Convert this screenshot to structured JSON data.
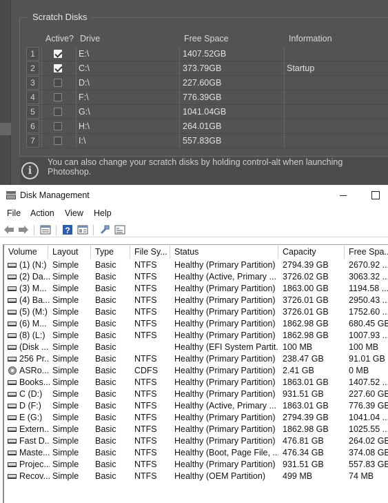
{
  "scratch": {
    "legend": "Scratch Disks",
    "headers": {
      "active": "Active?",
      "drive": "Drive",
      "free_space": "Free Space",
      "information": "Information"
    },
    "rows": [
      {
        "num": "1",
        "active": true,
        "drive": "E:\\",
        "free": "1407.52GB",
        "info": ""
      },
      {
        "num": "2",
        "active": true,
        "drive": "C:\\",
        "free": "373.79GB",
        "info": "Startup"
      },
      {
        "num": "3",
        "active": false,
        "drive": "D:\\",
        "free": "227.60GB",
        "info": ""
      },
      {
        "num": "4",
        "active": false,
        "drive": "F:\\",
        "free": "776.39GB",
        "info": ""
      },
      {
        "num": "5",
        "active": false,
        "drive": "G:\\",
        "free": "1041.04GB",
        "info": ""
      },
      {
        "num": "6",
        "active": false,
        "drive": "H:\\",
        "free": "264.01GB",
        "info": ""
      },
      {
        "num": "7",
        "active": false,
        "drive": "I:\\",
        "free": "557.83GB",
        "info": ""
      }
    ],
    "info_icon": "info-icon",
    "info_text": "You can also change your scratch disks by holding control-alt when launching Photoshop."
  },
  "diskmgmt": {
    "title": "Disk Management",
    "menu": [
      "File",
      "Action",
      "View",
      "Help"
    ],
    "toolbar_icons": [
      "back-arrow-icon",
      "forward-arrow-icon",
      "list-view-icon",
      "help-icon",
      "properties-icon",
      "connect-icon",
      "console-icon"
    ],
    "columns": [
      "Volume",
      "Layout",
      "Type",
      "File Sy...",
      "Status",
      "Capacity",
      "Free Spa..."
    ],
    "rows": [
      {
        "icon": "hdd",
        "volume": "(1) (N:)",
        "layout": "Simple",
        "type": "Basic",
        "fs": "NTFS",
        "status": "Healthy (Primary Partition)",
        "capacity": "2794.39 GB",
        "free": "2670.92 ..."
      },
      {
        "icon": "hdd",
        "volume": "(2) Da...",
        "layout": "Simple",
        "type": "Basic",
        "fs": "NTFS",
        "status": "Healthy (Active, Primary ...",
        "capacity": "3726.02 GB",
        "free": "3063.32 ..."
      },
      {
        "icon": "hdd",
        "volume": "(3) M...",
        "layout": "Simple",
        "type": "Basic",
        "fs": "NTFS",
        "status": "Healthy (Primary Partition)",
        "capacity": "1863.00 GB",
        "free": "1194.58 ..."
      },
      {
        "icon": "hdd",
        "volume": "(4) Ba...",
        "layout": "Simple",
        "type": "Basic",
        "fs": "NTFS",
        "status": "Healthy (Primary Partition)",
        "capacity": "3726.01 GB",
        "free": "2950.43 ..."
      },
      {
        "icon": "hdd",
        "volume": "(5) (M:)",
        "layout": "Simple",
        "type": "Basic",
        "fs": "NTFS",
        "status": "Healthy (Primary Partition)",
        "capacity": "3726.01 GB",
        "free": "1752.60 ..."
      },
      {
        "icon": "hdd",
        "volume": "(6) M...",
        "layout": "Simple",
        "type": "Basic",
        "fs": "NTFS",
        "status": "Healthy (Primary Partition)",
        "capacity": "1862.98 GB",
        "free": "680.45 GB"
      },
      {
        "icon": "hdd",
        "volume": "(8) (L:)",
        "layout": "Simple",
        "type": "Basic",
        "fs": "NTFS",
        "status": "Healthy (Primary Partition)",
        "capacity": "1862.98 GB",
        "free": "1007.93 ..."
      },
      {
        "icon": "hdd",
        "volume": "(Disk ...",
        "layout": "Simple",
        "type": "Basic",
        "fs": "",
        "status": "Healthy (EFI System Partit...",
        "capacity": "100 MB",
        "free": "100 MB"
      },
      {
        "icon": "hdd",
        "volume": "256 Pr...",
        "layout": "Simple",
        "type": "Basic",
        "fs": "NTFS",
        "status": "Healthy (Primary Partition)",
        "capacity": "238.47 GB",
        "free": "91.01 GB"
      },
      {
        "icon": "cd",
        "volume": "ASRo...",
        "layout": "Simple",
        "type": "Basic",
        "fs": "CDFS",
        "status": "Healthy (Primary Partition)",
        "capacity": "2.41 GB",
        "free": "0 MB"
      },
      {
        "icon": "hdd",
        "volume": "Books...",
        "layout": "Simple",
        "type": "Basic",
        "fs": "NTFS",
        "status": "Healthy (Primary Partition)",
        "capacity": "1863.01 GB",
        "free": "1407.52 ..."
      },
      {
        "icon": "hdd",
        "volume": "C (D:)",
        "layout": "Simple",
        "type": "Basic",
        "fs": "NTFS",
        "status": "Healthy (Primary Partition)",
        "capacity": "931.51 GB",
        "free": "227.60 GB"
      },
      {
        "icon": "hdd",
        "volume": "D (F:)",
        "layout": "Simple",
        "type": "Basic",
        "fs": "NTFS",
        "status": "Healthy (Active, Primary ...",
        "capacity": "1863.01 GB",
        "free": "776.39 GB"
      },
      {
        "icon": "hdd",
        "volume": "E (G:)",
        "layout": "Simple",
        "type": "Basic",
        "fs": "NTFS",
        "status": "Healthy (Primary Partition)",
        "capacity": "2794.39 GB",
        "free": "1041.04 ..."
      },
      {
        "icon": "hdd",
        "volume": "Extern...",
        "layout": "Simple",
        "type": "Basic",
        "fs": "NTFS",
        "status": "Healthy (Primary Partition)",
        "capacity": "1862.98 GB",
        "free": "1025.55 ..."
      },
      {
        "icon": "hdd",
        "volume": "Fast D...",
        "layout": "Simple",
        "type": "Basic",
        "fs": "NTFS",
        "status": "Healthy (Primary Partition)",
        "capacity": "476.81 GB",
        "free": "264.02 GB"
      },
      {
        "icon": "hdd",
        "volume": "Maste...",
        "layout": "Simple",
        "type": "Basic",
        "fs": "NTFS",
        "status": "Healthy (Boot, Page File, ...",
        "capacity": "476.34 GB",
        "free": "374.08 GB"
      },
      {
        "icon": "hdd",
        "volume": "Projec...",
        "layout": "Simple",
        "type": "Basic",
        "fs": "NTFS",
        "status": "Healthy (Primary Partition)",
        "capacity": "931.51 GB",
        "free": "557.83 GB"
      },
      {
        "icon": "hdd",
        "volume": "Recov...",
        "layout": "Simple",
        "type": "Basic",
        "fs": "NTFS",
        "status": "Healthy (OEM Partition)",
        "capacity": "499 MB",
        "free": "74 MB"
      }
    ]
  }
}
